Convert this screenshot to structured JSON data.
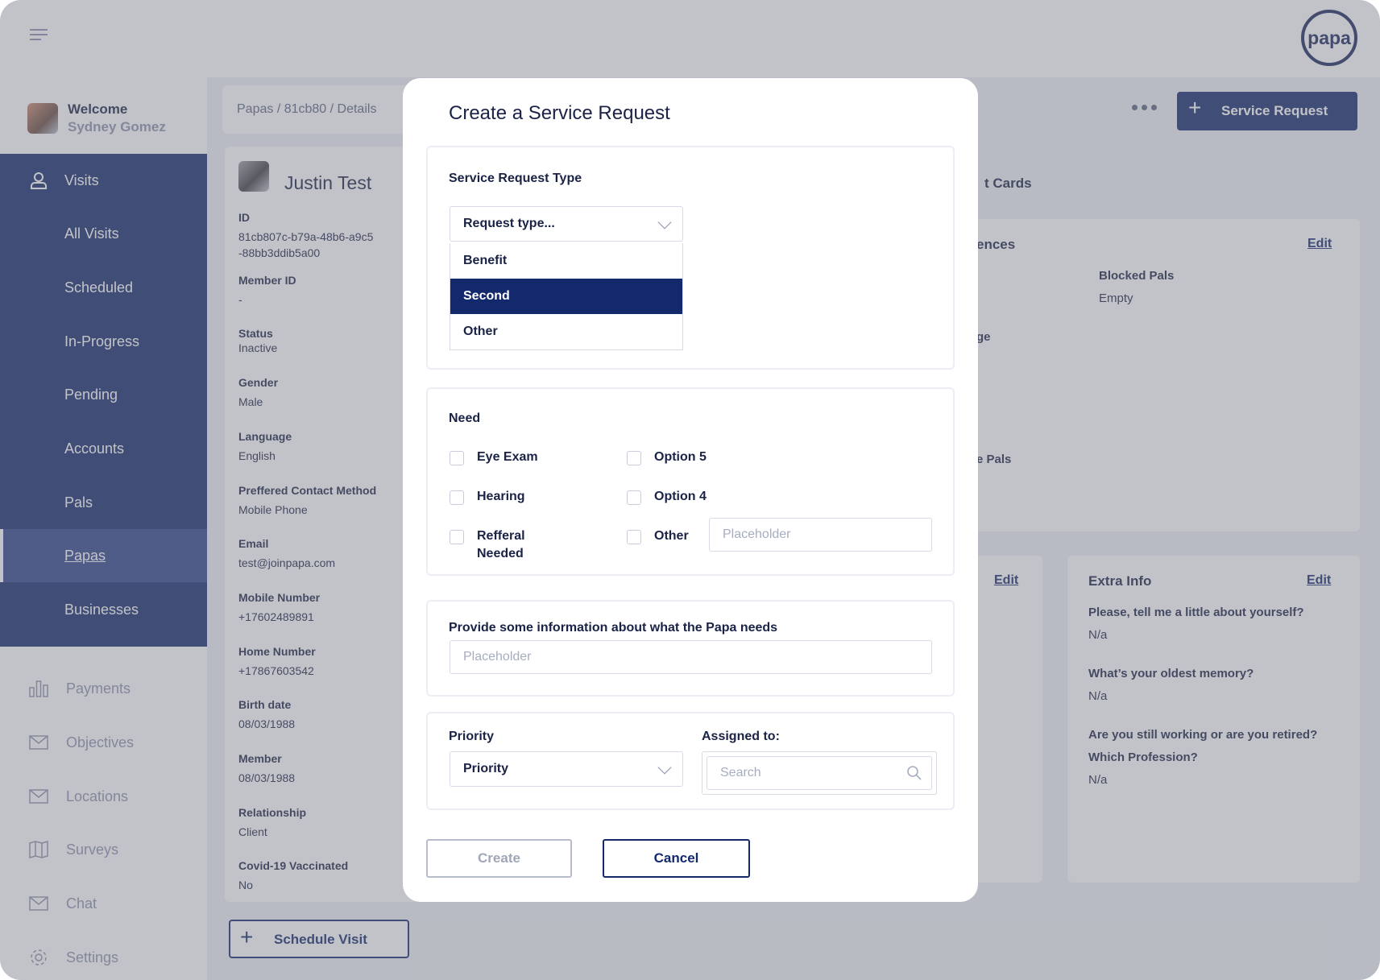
{
  "app": {
    "logo_text": "papa"
  },
  "user": {
    "welcome": "Welcome",
    "name": "Sydney Gomez"
  },
  "sidebar": {
    "primary": [
      {
        "label": "Visits"
      },
      {
        "label": "All Visits"
      },
      {
        "label": "Scheduled"
      },
      {
        "label": "In-Progress"
      },
      {
        "label": "Pending"
      },
      {
        "label": "Accounts"
      },
      {
        "label": "Pals"
      },
      {
        "label": "Papas"
      },
      {
        "label": "Businesses"
      }
    ],
    "secondary": [
      {
        "label": "Payments",
        "icon": "bar-chart-icon"
      },
      {
        "label": "Objectives",
        "icon": "mail-icon"
      },
      {
        "label": "Locations",
        "icon": "mail-icon"
      },
      {
        "label": "Surveys",
        "icon": "map-icon"
      },
      {
        "label": "Chat",
        "icon": "mail-icon"
      },
      {
        "label": "Settings",
        "icon": "gear-icon"
      }
    ]
  },
  "breadcrumb": "Papas / 81cb80 / Details",
  "header": {
    "service_request_label": "Service Request"
  },
  "member": {
    "name": "Justin Test",
    "fields": [
      {
        "key": "ID",
        "value": "81cb807c-b79a-48b6-a9c5\n-88bb3ddib5a00"
      },
      {
        "key": "Member ID",
        "value": "-"
      },
      {
        "key": "Status",
        "value": "Inactive"
      },
      {
        "key": "Gender",
        "value": "Male"
      },
      {
        "key": "Language",
        "value": "English"
      },
      {
        "key": "Preffered Contact Method",
        "value": "Mobile Phone"
      },
      {
        "key": "Email",
        "value": "test@joinpapa.com"
      },
      {
        "key": "Mobile Number",
        "value": "+17602489891"
      },
      {
        "key": "Home Number",
        "value": "+17867603542"
      },
      {
        "key": "Birth date",
        "value": "08/03/1988"
      },
      {
        "key": "Member",
        "value": "08/03/1988"
      },
      {
        "key": "Relationship",
        "value": "Client"
      },
      {
        "key": "Covid-19 Vaccinated",
        "value": "No"
      }
    ],
    "schedule_visit_label": "Schedule Visit"
  },
  "background_cards": {
    "tab_partial": "t Cards",
    "prefs_title_partial": "ences",
    "edit_label": "Edit",
    "blocked_pals_label": "Blocked Pals",
    "blocked_pals_value": "Empty",
    "partial_ge": "ge",
    "partial_pals": "e Pals",
    "extra_info": {
      "title": "Extra Info",
      "q1": "Please, tell me a little about yourself?",
      "a1": "N/a",
      "q2": "What’s your oldest memory?",
      "a2": "N/a",
      "q3": "Are you still working or are you retired?",
      "q3b": "Which Profession?",
      "a3": "N/a"
    }
  },
  "modal": {
    "title": "Create a Service Request",
    "type_section": {
      "label": "Service Request Type",
      "placeholder": "Request type...",
      "options": [
        "Benefit",
        "Second",
        "Other"
      ],
      "selected_index": 1
    },
    "need_section": {
      "label": "Need",
      "options_left": [
        "Eye Exam",
        "Hearing",
        "Refferal\nNeeded"
      ],
      "options_right": [
        "Option 5",
        "Option 4",
        "Other"
      ],
      "other_placeholder": "Placeholder"
    },
    "info_section": {
      "label": "Provide some information about what the Papa needs",
      "placeholder": "Placeholder"
    },
    "priority_section": {
      "priority_label": "Priority",
      "priority_value": "Priority",
      "assigned_label": "Assigned to:",
      "search_placeholder": "Search"
    },
    "buttons": {
      "create": "Create",
      "cancel": "Cancel"
    }
  },
  "colors": {
    "navy": "#13296b",
    "active_nav": "#2d4489",
    "muted": "#8a93ad"
  }
}
